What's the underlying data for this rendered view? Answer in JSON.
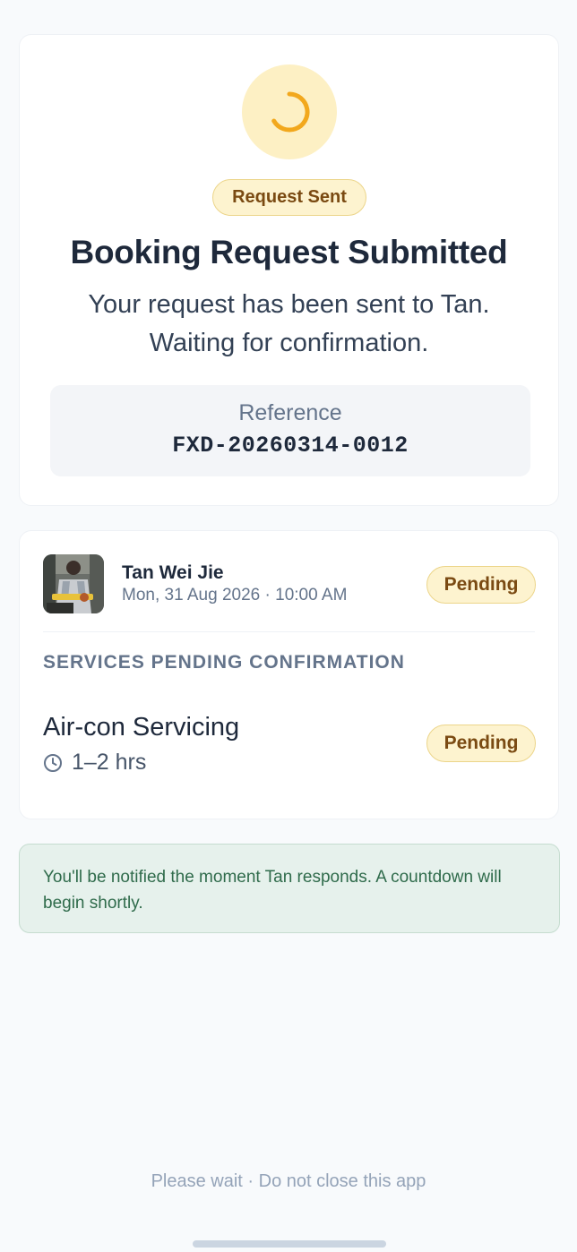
{
  "status": {
    "badge": "Request Sent",
    "title": "Booking Request Submitted",
    "message": "Your request has been sent to Tan. Waiting for confirmation."
  },
  "reference": {
    "label": "Reference",
    "value": "FXD-20260314-0012"
  },
  "booking": {
    "provider_name": "Tan Wei Jie",
    "datetime": "Mon, 31 Aug 2026 · 10:00 AM",
    "status_badge": "Pending",
    "section_label": "SERVICES PENDING CONFIRMATION",
    "services": [
      {
        "name": "Air-con Servicing",
        "duration": "1–2 hrs",
        "status": "Pending"
      }
    ]
  },
  "info_banner": "You'll be notified the moment Tan responds. A countdown will begin shortly.",
  "footer": "Please wait · Do not close this app",
  "icons": {
    "status": "loading-spinner-icon",
    "duration": "clock-icon"
  },
  "colors": {
    "accent": "#f2a81d",
    "pending_bg": "#fdf3cf",
    "pending_text": "#7a4a12",
    "info_bg": "#e6f1ec",
    "info_text": "#2f6b4b"
  }
}
